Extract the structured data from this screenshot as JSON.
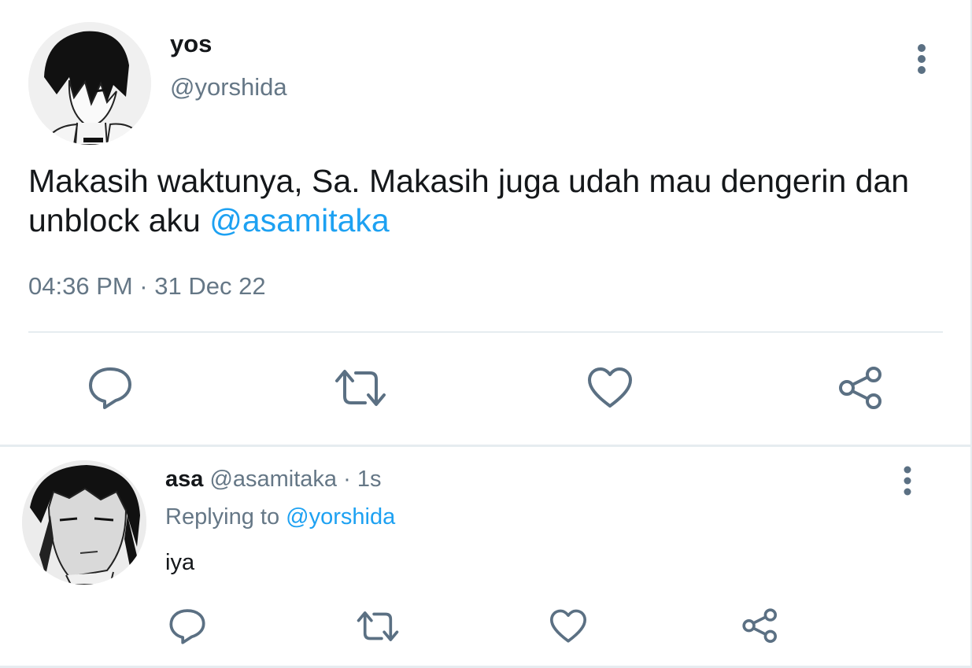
{
  "main_tweet": {
    "display_name": "yos",
    "handle": "@yorshida",
    "text": "Makasih waktunya, Sa. Makasih juga udah mau dengerin dan unblock aku ",
    "mention": "@asamitaka",
    "timestamp": "04:36 PM · 31 Dec 22"
  },
  "reply_tweet": {
    "display_name": "asa",
    "meta": " @asamitaka · 1s",
    "replying_prefix": "Replying to ",
    "replying_handle": "@yorshida",
    "text": "iya"
  },
  "icons": {
    "reply": "reply-icon",
    "retweet": "retweet-icon",
    "like": "heart-icon",
    "share": "share-icon",
    "more": "more-vertical-icon"
  },
  "colors": {
    "link": "#1da1f2",
    "secondary_text": "#657786",
    "primary_text": "#14171a",
    "icon": "#5b7083",
    "divider": "#e6ecf0"
  }
}
